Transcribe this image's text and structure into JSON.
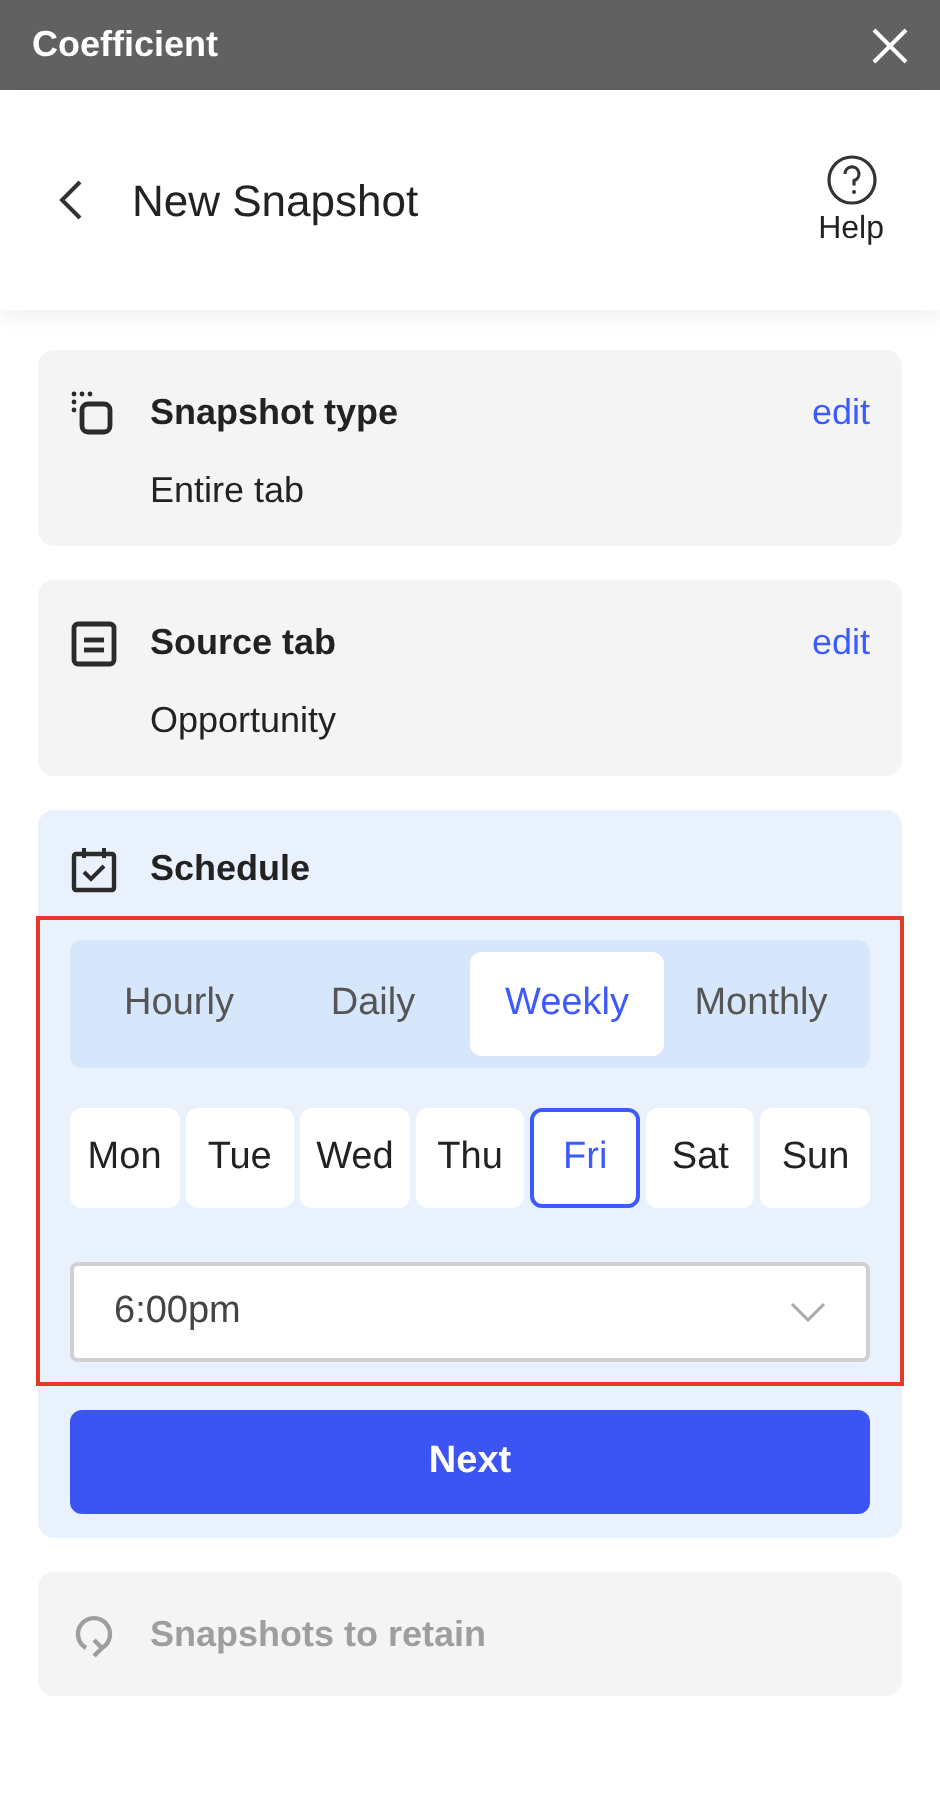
{
  "window": {
    "title": "Coefficient"
  },
  "header": {
    "title": "New Snapshot",
    "help": "Help"
  },
  "steps": [
    {
      "kind": "summary",
      "title": "Snapshot type",
      "action": "edit",
      "value": "Entire tab"
    },
    {
      "kind": "summary",
      "title": "Source tab",
      "action": "edit",
      "value": "Opportunity"
    },
    {
      "kind": "schedule",
      "title": "Schedule",
      "frequencies": [
        {
          "label": "Hourly",
          "selected": false
        },
        {
          "label": "Daily",
          "selected": false
        },
        {
          "label": "Weekly",
          "selected": true
        },
        {
          "label": "Monthly",
          "selected": false
        }
      ],
      "days": [
        {
          "label": "Mon",
          "selected": false
        },
        {
          "label": "Tue",
          "selected": false
        },
        {
          "label": "Wed",
          "selected": false
        },
        {
          "label": "Thu",
          "selected": false
        },
        {
          "label": "Fri",
          "selected": true
        },
        {
          "label": "Sat",
          "selected": false
        },
        {
          "label": "Sun",
          "selected": false
        }
      ],
      "time": "6:00pm",
      "button": "Next"
    },
    {
      "kind": "disabled",
      "title": "Snapshots to retain"
    }
  ]
}
